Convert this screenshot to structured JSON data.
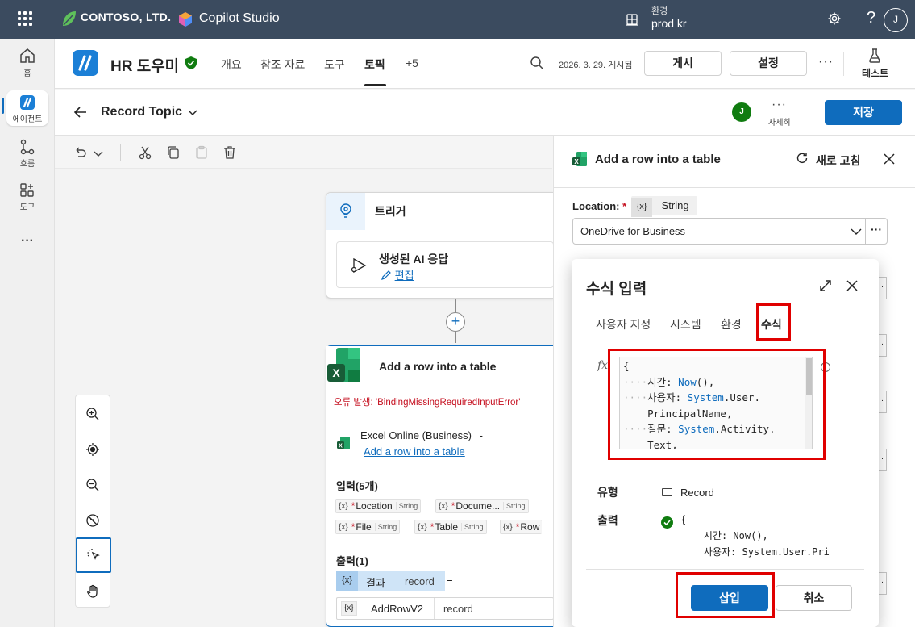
{
  "topbar": {
    "brand": "CONTOSO, LTD.",
    "product": "Copilot Studio",
    "env_label": "환경",
    "env_value": "prod kr",
    "help": "?",
    "user_initial": "J"
  },
  "rail": {
    "items": [
      {
        "label": "홈"
      },
      {
        "label": "에이전트"
      },
      {
        "label": "흐름"
      },
      {
        "label": "도구"
      },
      {
        "label": "···"
      }
    ]
  },
  "agent": {
    "name": "HR 도우미",
    "tabs": [
      "개요",
      "참조 자료",
      "도구",
      "토픽",
      "+5"
    ],
    "active_tab": "토픽",
    "published": "2026. 3. 29. 게시됨",
    "publish_label": "게시",
    "settings_label": "설정",
    "more": "···",
    "test_label": "테스트"
  },
  "topic": {
    "name": "Record Topic",
    "avatar_initial": "J",
    "details_label": "자세히",
    "more": "···",
    "save_label": "저장"
  },
  "canvas": {
    "trigger_title": "트리거",
    "trigger_item": "생성된 AI 응답",
    "edit_link": "편집",
    "action_title": "Add a row into a table",
    "error_text": "오류 발생: 'BindingMissingRequiredInputError'",
    "connector": "Excel Online (Business)",
    "connector_dash": "-",
    "action_link": "Add a row into a table",
    "inputs_header": "입력(5개)",
    "inputs": [
      {
        "name": "Location",
        "type": "String"
      },
      {
        "name": "Docume...",
        "type": "String"
      },
      {
        "name": "File",
        "type": "String"
      },
      {
        "name": "Table",
        "type": "String"
      },
      {
        "name": "Row",
        "type": ""
      }
    ],
    "outputs_header": "출력(1)",
    "output_var": "결과",
    "output_type": "record",
    "equals": "=",
    "addrow_var": "AddRowV2",
    "addrow_type": "record",
    "var_token": "{x}",
    "required_mark": "*"
  },
  "panel": {
    "title": "Add a row into a table",
    "refresh_label": "새로 고침",
    "location_label": "Location:",
    "required_mark": "*",
    "location_token": "{x}",
    "location_type": "String",
    "location_value": "OneDrive for Business",
    "more": "···"
  },
  "formula": {
    "title": "수식 입력",
    "tabs": [
      "사용자 지정",
      "시스템",
      "환경",
      "수식"
    ],
    "active_tab": "수식",
    "fx": "fx",
    "code_lines": [
      {
        "indent": "",
        "key": "{",
        "fn": "",
        "tail": ""
      },
      {
        "indent": "····",
        "key": "시간: ",
        "fn": "Now",
        "tail": "(),"
      },
      {
        "indent": "····",
        "key": "사용자: ",
        "fn": "System",
        "tail": ".User."
      },
      {
        "indent": "    ",
        "key": "PrincipalName,",
        "fn": "",
        "tail": ""
      },
      {
        "indent": "····",
        "key": "질문: ",
        "fn": "System",
        "tail": ".Activity."
      },
      {
        "indent": "    ",
        "key": "Text,",
        "fn": "",
        "tail": ""
      }
    ],
    "type_label": "유형",
    "type_value": "Record",
    "output_label": "출력",
    "output_lines": [
      "{",
      "    시간: Now(),",
      "    사용자: System.User.Pri"
    ],
    "insert_label": "삽입",
    "cancel_label": "취소"
  },
  "colors": {
    "topbar": "#3b4b5f",
    "accent": "#0f6cbd",
    "highlight": "#e00000",
    "success": "#107c10"
  }
}
